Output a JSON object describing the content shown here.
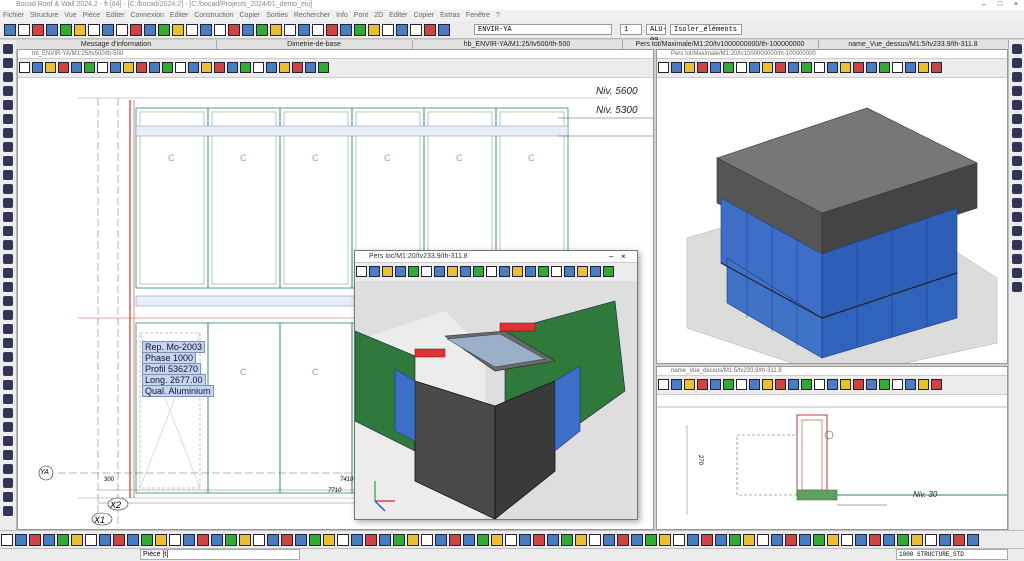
{
  "app": {
    "title": "Bocad Roof & Wall 2024.2 - ft [84] - [C:/bocad/2024.2] - [C:/bocad/Projects_2024/01_demo_eiu]",
    "window_buttons": [
      "–",
      "□",
      "×"
    ]
  },
  "menu": [
    "Fichier",
    "Structure",
    "Vue",
    "Pièce",
    "Editer",
    "Connexion",
    "Editer",
    "Construction",
    "Copier",
    "Sorties",
    "Rechercher",
    "Info",
    "Pont",
    "2D",
    "Editer",
    "Copier",
    "Extras",
    "Fenêtre",
    "?"
  ],
  "toolbar": {
    "combo_main": "ENVIR-YA",
    "combo_num": "1",
    "combo_alu": "ALU-00",
    "combo_isolate": "Isoler_éléments"
  },
  "tabs": [
    "Message d'information",
    "Dimetrie-de-base",
    "hb_ENVIR-YA/M1:25/tv500/th-500",
    "Pers tot/Maximale/M1:20/tv1000000000/th-100000000",
    "name_Vue_dessus/M1:5/tv233.9/th-311.8"
  ],
  "panes": {
    "left": {
      "header": "hb_ENVIR-YA/M1:25/tv500/th-500",
      "niv_top": "Niv. 5600",
      "niv_bottom": "Niv. 5300",
      "axis_ya": "YA",
      "axis_x1": "X1",
      "axis_x2": "X2",
      "dim_300": "300",
      "dim_7410": "7410",
      "dim_7710": "7710",
      "info": [
        "Rep.  Mo-2003",
        "Phase 1000",
        "Profil  536270",
        "Long. 2677.00",
        "Qual. Aluminium"
      ],
      "panel_labels": [
        "C",
        "C",
        "C",
        "C",
        "C",
        "C",
        "C",
        "C",
        "C",
        "C"
      ]
    },
    "right_top": {
      "header": "Pers tot/Maximale/M1:20/tv1000000000/th-100000000"
    },
    "right_bottom": {
      "header": "name_Vue_dessus/M1:5/tv233.9/th-311.8",
      "niv": "Niv. 30",
      "dim_270": "270"
    },
    "float": {
      "title": "Pers loc/M1:20/tv233.9/th-311.8"
    }
  },
  "status": {
    "piece": "Pièce [t]",
    "structure": "1000 STRUCTURE_STD"
  }
}
